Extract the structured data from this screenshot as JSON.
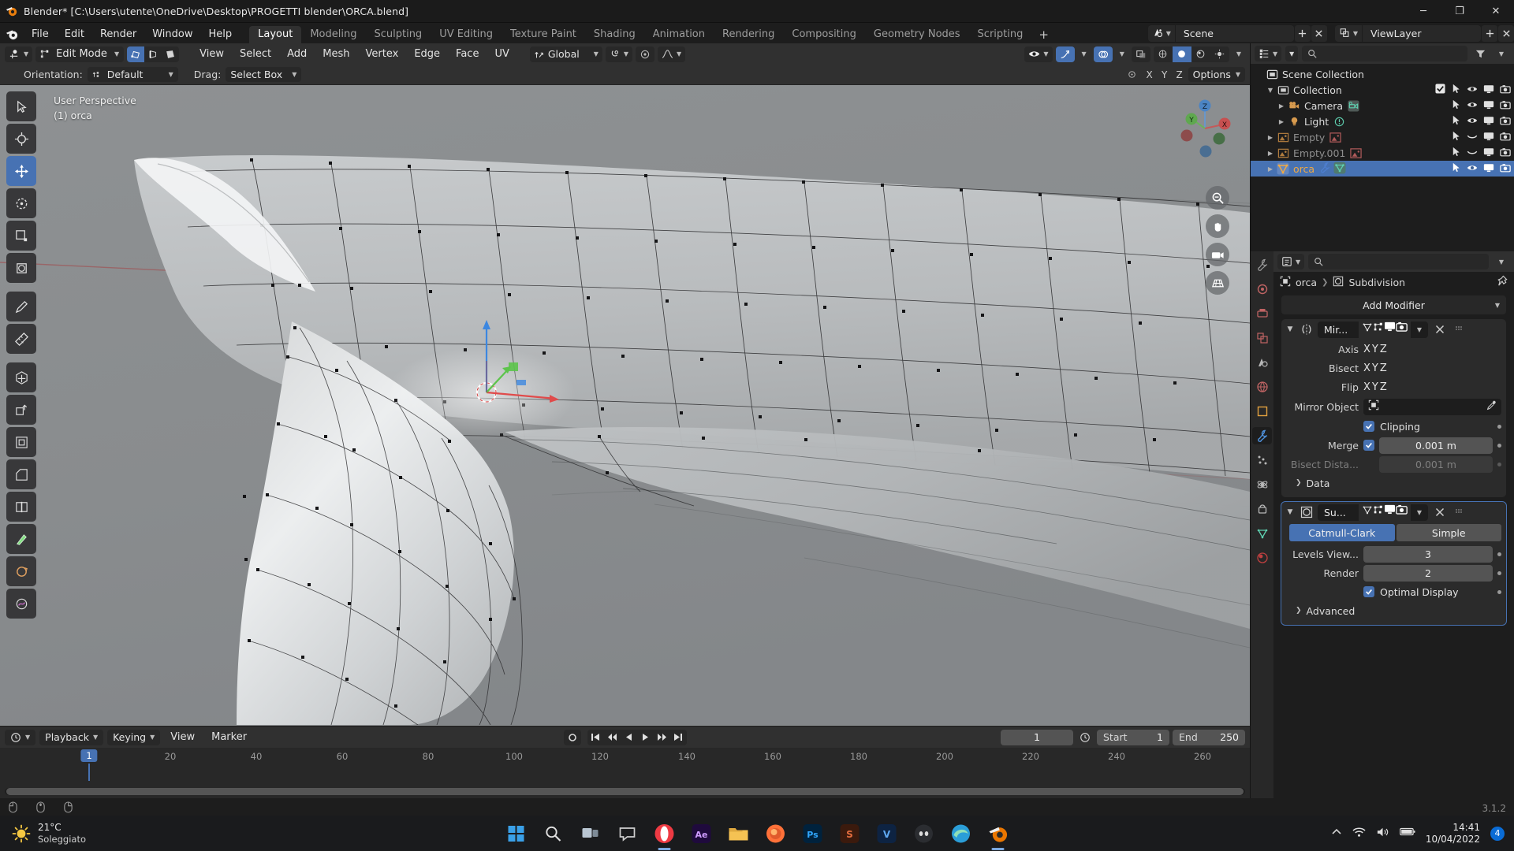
{
  "window": {
    "title": "Blender* [C:\\Users\\utente\\OneDrive\\Desktop\\PROGETTI blender\\ORCA.blend]",
    "minimize": "─",
    "maximize": "❐",
    "close": "✕"
  },
  "topbar": {
    "menus": [
      "File",
      "Edit",
      "Render",
      "Window",
      "Help"
    ],
    "workspaces": [
      {
        "label": "Layout",
        "active": true
      },
      {
        "label": "Modeling",
        "active": false
      },
      {
        "label": "Sculpting",
        "active": false
      },
      {
        "label": "UV Editing",
        "active": false
      },
      {
        "label": "Texture Paint",
        "active": false
      },
      {
        "label": "Shading",
        "active": false
      },
      {
        "label": "Animation",
        "active": false
      },
      {
        "label": "Rendering",
        "active": false
      },
      {
        "label": "Compositing",
        "active": false
      },
      {
        "label": "Geometry Nodes",
        "active": false
      },
      {
        "label": "Scripting",
        "active": false
      }
    ],
    "add_workspace": "+",
    "scene_name": "Scene",
    "viewlayer_name": "ViewLayer"
  },
  "viewport_header": {
    "mode": "Edit Mode",
    "menus": [
      "View",
      "Select",
      "Add",
      "Mesh",
      "Vertex",
      "Edge",
      "Face",
      "UV"
    ],
    "transform_orientation": "Global",
    "select_modes": [
      "vertex-select",
      "edge-select",
      "face-select"
    ],
    "active_select_mode": "vertex-select"
  },
  "tool_settings": {
    "orientation_label": "Orientation:",
    "orientation_value": "Default",
    "drag_label": "Drag:",
    "drag_value": "Select Box",
    "options_label": "Options",
    "axis_locks": [
      "X",
      "Y",
      "Z"
    ]
  },
  "viewport": {
    "perspective": "User Perspective",
    "active_object": "(1) orca",
    "gizmo_axes": [
      "X",
      "Y",
      "Z"
    ],
    "background_color": "#8a8d8f"
  },
  "timeline": {
    "playback": "Playback",
    "keying": "Keying",
    "view": "View",
    "marker": "Marker",
    "current_frame": "1",
    "start_label": "Start",
    "start_value": "1",
    "end_label": "End",
    "end_value": "250",
    "ticks": [
      "20",
      "40",
      "60",
      "80",
      "100",
      "120",
      "140",
      "160",
      "180",
      "200",
      "220",
      "240",
      "260"
    ],
    "playhead_label": "1"
  },
  "outliner": {
    "root": "Scene Collection",
    "search_placeholder": "",
    "rows": [
      {
        "name": "Collection",
        "depth": 1,
        "icon": "collection-icon",
        "dim": false,
        "selected": false,
        "disclosure": "▼",
        "checkbox": true,
        "extra": null,
        "restrict": [
          "cursor",
          "eye",
          "screen",
          "camera"
        ]
      },
      {
        "name": "Camera",
        "depth": 2,
        "icon": "camera-data-icon",
        "dim": false,
        "selected": false,
        "disclosure": "▶",
        "checkbox": false,
        "extra": "camera-green-icon",
        "restrict": [
          "cursor",
          "eye",
          "screen",
          "camera"
        ]
      },
      {
        "name": "Light",
        "depth": 2,
        "icon": "light-icon",
        "dim": false,
        "selected": false,
        "disclosure": "▶",
        "checkbox": false,
        "extra": "light-green-icon",
        "restrict": [
          "cursor",
          "eye",
          "screen",
          "camera"
        ]
      },
      {
        "name": "Empty",
        "depth": 1,
        "icon": "empty-image-icon",
        "dim": true,
        "selected": false,
        "disclosure": "▶",
        "checkbox": false,
        "extra": "image-red-icon",
        "restrict": [
          "cursor",
          "eye-closed",
          "screen",
          "camera"
        ]
      },
      {
        "name": "Empty.001",
        "depth": 1,
        "icon": "empty-image-icon",
        "dim": true,
        "selected": false,
        "disclosure": "▶",
        "checkbox": false,
        "extra": "image-red-icon",
        "restrict": [
          "cursor",
          "eye-closed",
          "screen",
          "camera"
        ]
      },
      {
        "name": "orca",
        "depth": 1,
        "icon": "mesh-object-icon",
        "dim": false,
        "selected": true,
        "disclosure": "▶",
        "checkbox": false,
        "extra": "modifier-mesh-icon",
        "restrict": [
          "cursor",
          "eye",
          "screen",
          "camera"
        ]
      }
    ]
  },
  "properties": {
    "breadcrumb_object": "orca",
    "breadcrumb_modifier": "Subdivision",
    "add_modifier": "Add Modifier",
    "search_placeholder": "",
    "modifiers": [
      {
        "name": "Mir...",
        "full_name": "Mirror",
        "selected": false,
        "type_icon": "mirror-icon",
        "toggles": [
          {
            "name": "on-cage",
            "on": false
          },
          {
            "name": "edit-mode",
            "on": true
          },
          {
            "name": "realtime",
            "on": true
          },
          {
            "name": "render",
            "on": true
          }
        ],
        "rows": [
          {
            "kind": "xyz",
            "label": "Axis",
            "values": [
              "X",
              "Y",
              "Z"
            ],
            "active": [
              false,
              true,
              false
            ]
          },
          {
            "kind": "xyz",
            "label": "Bisect",
            "values": [
              "X",
              "Y",
              "Z"
            ],
            "active": [
              false,
              false,
              false
            ]
          },
          {
            "kind": "xyz",
            "label": "Flip",
            "values": [
              "X",
              "Y",
              "Z"
            ],
            "active": [
              false,
              false,
              false
            ]
          },
          {
            "kind": "object",
            "label": "Mirror Object",
            "value": ""
          },
          {
            "kind": "check",
            "label": "",
            "checkbox_label": "Clipping",
            "checked": true,
            "animdot": true
          },
          {
            "kind": "checkval",
            "label": "Merge",
            "checked": true,
            "value": "0.001 m",
            "animdot": true
          },
          {
            "kind": "val",
            "label": "Bisect Dista...",
            "value": "0.001 m",
            "dim": true,
            "animdot": true
          },
          {
            "kind": "subpanel",
            "label": "Data"
          }
        ]
      },
      {
        "name": "Su...",
        "full_name": "Subdivision",
        "selected": true,
        "type_icon": "subdivision-icon",
        "toggles": [
          {
            "name": "on-cage",
            "on": false
          },
          {
            "name": "edit-mode",
            "on": true
          },
          {
            "name": "realtime",
            "on": true
          },
          {
            "name": "render",
            "on": true
          }
        ],
        "rows": [
          {
            "kind": "seg",
            "options": [
              "Catmull-Clark",
              "Simple"
            ],
            "active": 0
          },
          {
            "kind": "val",
            "label": "Levels View...",
            "value": "3",
            "dim": false,
            "animdot": true
          },
          {
            "kind": "val",
            "label": "Render",
            "value": "2",
            "dim": false,
            "animdot": true
          },
          {
            "kind": "check",
            "label": "",
            "checkbox_label": "Optimal Display",
            "checked": true,
            "animdot": true
          },
          {
            "kind": "subpanel",
            "label": "Advanced"
          }
        ]
      }
    ]
  },
  "statusbar": {
    "version": "3.1.2"
  },
  "taskbar": {
    "weather_temp": "21°C",
    "weather_desc": "Soleggiato",
    "time": "14:41",
    "date": "10/04/2022",
    "notification_count": "4",
    "apps": [
      {
        "name": "start-button",
        "glyph": "⊞",
        "color": "#3aa0e8",
        "running": false
      },
      {
        "name": "search-button",
        "glyph": "⚲",
        "color": "#dddddd",
        "running": false
      },
      {
        "name": "task-view-button",
        "glyph": "▭",
        "color": "#cccccc",
        "running": false
      },
      {
        "name": "chat-button",
        "glyph": "⌨",
        "color": "#cccccc",
        "running": false
      },
      {
        "name": "opera-app",
        "glyph": "O",
        "color": "#ef3e3e",
        "running": true
      },
      {
        "name": "after-effects-app",
        "glyph": "Ae",
        "color": "#cf9cff",
        "running": false
      },
      {
        "name": "file-explorer-app",
        "glyph": "▬",
        "color": "#f5c253",
        "running": false
      },
      {
        "name": "firefox-app",
        "glyph": "●",
        "color": "#ff7139",
        "running": false
      },
      {
        "name": "photoshop-app",
        "glyph": "Ps",
        "color": "#31a8ff",
        "running": false
      },
      {
        "name": "substance-app",
        "glyph": "S",
        "color": "#e26c3e",
        "running": false
      },
      {
        "name": "vegas-app",
        "glyph": "V",
        "color": "#3c7fd0",
        "running": false
      },
      {
        "name": "discord-app",
        "glyph": "◑",
        "color": "#d8d8d8",
        "running": false
      },
      {
        "name": "edge-app",
        "glyph": "◔",
        "color": "#45b7e8",
        "running": false
      },
      {
        "name": "blender-app",
        "glyph": "⬤",
        "color": "#ea7600",
        "running": true
      }
    ]
  }
}
